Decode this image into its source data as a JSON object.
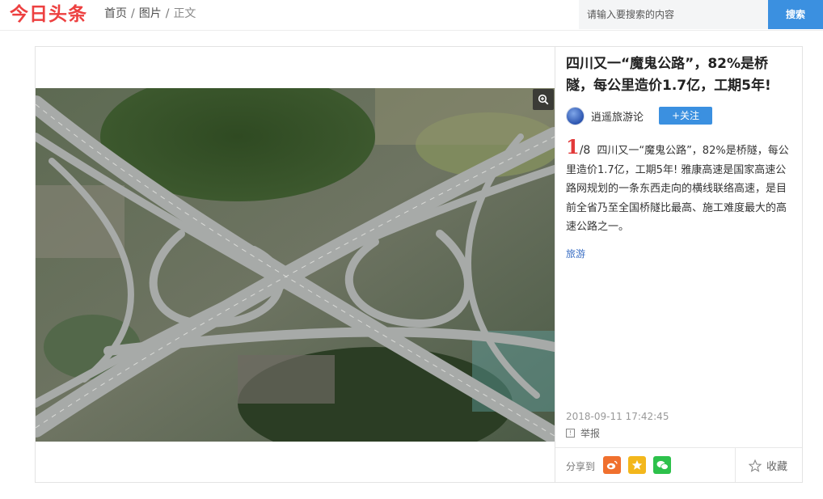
{
  "header": {
    "logo": "今日头条",
    "breadcrumb": [
      "首页",
      "图片",
      "正文"
    ],
    "search_placeholder": "请输入要搜索的内容",
    "search_button": "搜索"
  },
  "article": {
    "title": "四川又一“魔鬼公路”，82%是桥隧，每公里造价1.7亿，工期5年!",
    "author": "逍遥旅游论",
    "follow_label": "+关注",
    "image_index": "1",
    "image_total": "/8",
    "description": "四川又一“魔鬼公路”，82%是桥隧，每公里造价1.7亿，工期5年! 雅康高速是国家高速公路网规划的一条东西走向的横线联络高速，是目前全省乃至全国桥隧比最高、施工难度最大的高速公路之一。",
    "tag": "旅游",
    "datetime": "2018-09-11 17:42:45",
    "report_label": "举报",
    "share_label": "分享到",
    "favorite_label": "收藏"
  },
  "icons": {
    "zoom": "zoom-in-icon",
    "weibo": "weibo-icon",
    "qzone": "qzone-star-icon",
    "wechat": "wechat-icon",
    "favorite": "star-outline-icon",
    "report": "report-icon"
  },
  "colors": {
    "brand": "#ed4040",
    "accent": "#3b90e0",
    "index": "#e23a3a"
  }
}
